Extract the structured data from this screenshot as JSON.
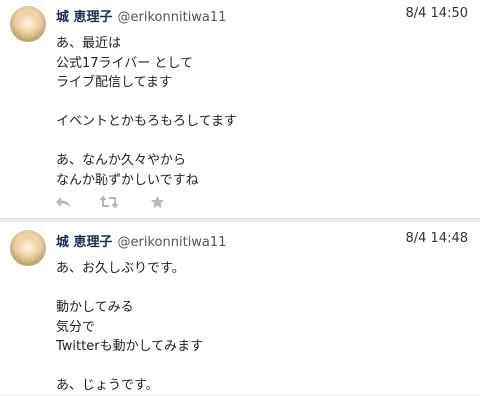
{
  "tweets": [
    {
      "name": "城 恵理子",
      "handle": "@erikonnitiwa11",
      "time": "8/4 14:50",
      "lines": [
        "あ、最近は",
        "公式17ライバー として",
        "ライブ配信してます",
        "",
        "イベントとかもろもろしてます",
        "",
        "あ、なんか久々やから",
        "なんか恥ずかしいですね"
      ]
    },
    {
      "name": "城 恵理子",
      "handle": "@erikonnitiwa11",
      "time": "8/4 14:48",
      "lines": [
        "あ、お久しぶりです。",
        "",
        "動かしてみる",
        "気分で",
        "Twitterも動かしてみます",
        "",
        "あ、じょうです。"
      ]
    }
  ],
  "icons": {
    "reply": "reply-icon",
    "retweet": "retweet-icon",
    "favorite": "star-icon"
  }
}
